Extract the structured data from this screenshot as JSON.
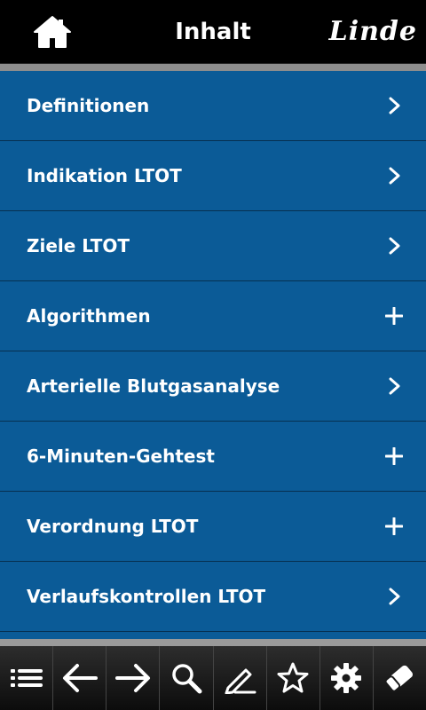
{
  "header": {
    "title": "Inhalt",
    "logo_text": "Linde",
    "home_icon": "home-icon"
  },
  "menu": {
    "items": [
      {
        "label": "Definitionen",
        "indicator": "chevron-right-icon"
      },
      {
        "label": "Indikation LTOT",
        "indicator": "chevron-right-icon"
      },
      {
        "label": "Ziele LTOT",
        "indicator": "chevron-right-icon"
      },
      {
        "label": "Algorithmen",
        "indicator": "plus-icon"
      },
      {
        "label": "Arterielle Blutgasanalyse",
        "indicator": "chevron-right-icon"
      },
      {
        "label": "6-Minuten-Gehtest",
        "indicator": "plus-icon"
      },
      {
        "label": "Verordnung LTOT",
        "indicator": "plus-icon"
      },
      {
        "label": "Verlaufskontrollen LTOT",
        "indicator": "chevron-right-icon"
      }
    ]
  },
  "toolbar": {
    "buttons": [
      {
        "icon": "list-icon"
      },
      {
        "icon": "arrow-left-icon"
      },
      {
        "icon": "arrow-right-icon"
      },
      {
        "icon": "search-icon"
      },
      {
        "icon": "pencil-icon"
      },
      {
        "icon": "star-icon"
      },
      {
        "icon": "gear-icon"
      },
      {
        "icon": "eraser-icon"
      }
    ]
  },
  "colors": {
    "list_background": "#0b5b97",
    "header_background": "#000000",
    "separator": "#8d8d8d"
  }
}
